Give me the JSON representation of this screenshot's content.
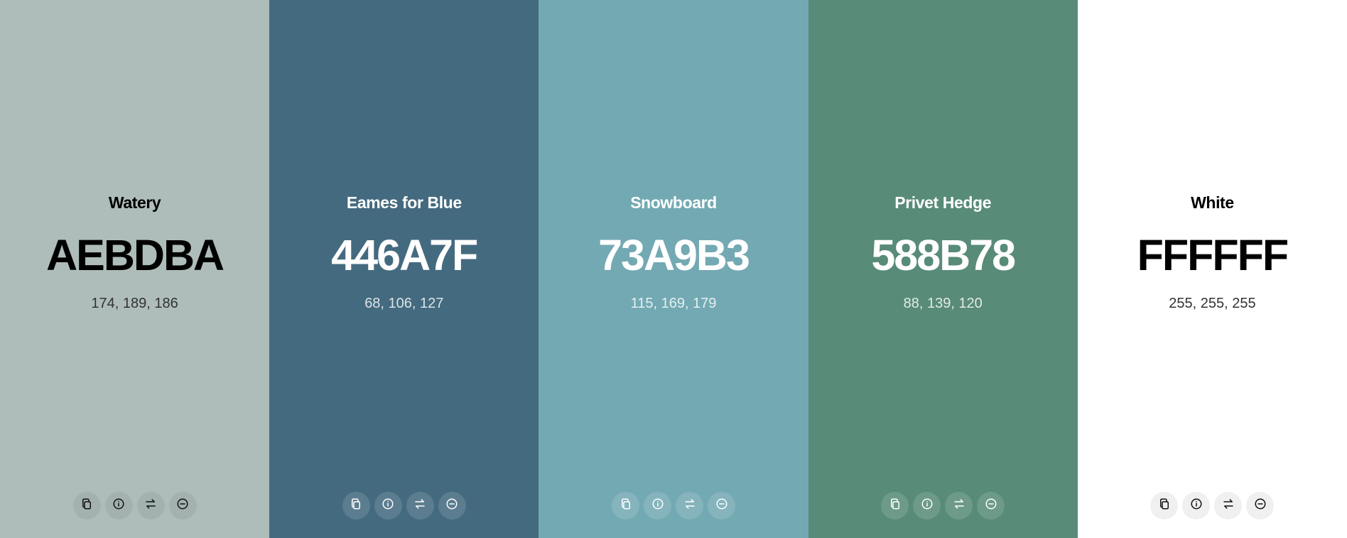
{
  "swatches": [
    {
      "name": "Watery",
      "hex": "AEBDBA",
      "rgb": "174, 189, 186",
      "color": "#AEBDBA",
      "text_tone": "dark"
    },
    {
      "name": "Eames for Blue",
      "hex": "446A7F",
      "rgb": "68, 106, 127",
      "color": "#446A7F",
      "text_tone": "light"
    },
    {
      "name": "Snowboard",
      "hex": "73A9B3",
      "rgb": "115, 169, 179",
      "color": "#73A9B3",
      "text_tone": "light"
    },
    {
      "name": "Privet Hedge",
      "hex": "588B78",
      "rgb": "88, 139, 120",
      "color": "#588B78",
      "text_tone": "light"
    },
    {
      "name": "White",
      "hex": "FFFFFF",
      "rgb": "255, 255, 255",
      "color": "#FFFFFF",
      "text_tone": "dark"
    }
  ],
  "actions": [
    {
      "id": "copy",
      "icon": "copy-icon"
    },
    {
      "id": "info",
      "icon": "info-icon"
    },
    {
      "id": "swap",
      "icon": "swap-arrows-icon"
    },
    {
      "id": "remove",
      "icon": "minus-circle-icon"
    }
  ]
}
